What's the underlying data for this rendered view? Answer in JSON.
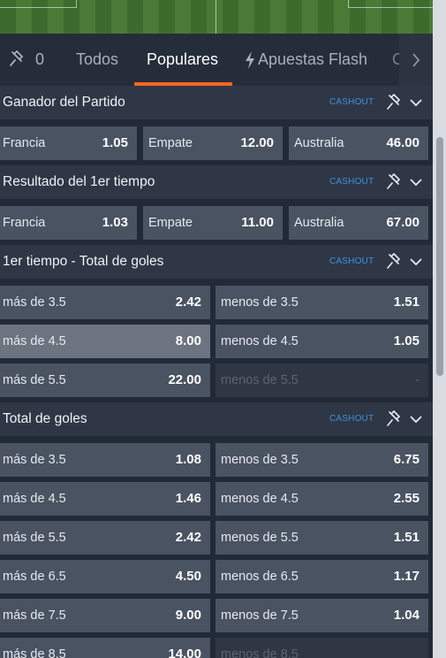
{
  "tabs": {
    "pinned_count": "0",
    "items": [
      "Todos",
      "Populares",
      "Apuestas Flash",
      "C"
    ],
    "active": "Populares",
    "accent_color": "#f26522"
  },
  "markets": [
    {
      "title": "Ganador del Partido",
      "cashout": "CASHOUT",
      "outcomes": [
        {
          "label": "Francia",
          "odds": "1.05"
        },
        {
          "label": "Empate",
          "odds": "12.00"
        },
        {
          "label": "Australia",
          "odds": "46.00"
        }
      ]
    },
    {
      "title": "Resultado del 1er tiempo",
      "cashout": "CASHOUT",
      "outcomes": [
        {
          "label": "Francia",
          "odds": "1.03"
        },
        {
          "label": "Empate",
          "odds": "11.00"
        },
        {
          "label": "Australia",
          "odds": "67.00"
        }
      ]
    },
    {
      "title": "1er tiempo - Total de goles",
      "cashout": "CASHOUT",
      "rows": [
        {
          "over": {
            "label": "más de 3.5",
            "odds": "2.42"
          },
          "under": {
            "label": "menos de 3.5",
            "odds": "1.51"
          }
        },
        {
          "over": {
            "label": "más de 4.5",
            "odds": "8.00"
          },
          "under": {
            "label": "menos de 4.5",
            "odds": "1.05"
          }
        },
        {
          "over": {
            "label": "más de 5.5",
            "odds": "22.00"
          },
          "under": {
            "label": "menos de 5.5",
            "odds": "-"
          }
        }
      ]
    },
    {
      "title": "Total de goles",
      "cashout": "CASHOUT",
      "rows": [
        {
          "over": {
            "label": "más de 3.5",
            "odds": "1.08"
          },
          "under": {
            "label": "menos de 3.5",
            "odds": "6.75"
          }
        },
        {
          "over": {
            "label": "más de 4.5",
            "odds": "1.46"
          },
          "under": {
            "label": "menos de 4.5",
            "odds": "2.55"
          }
        },
        {
          "over": {
            "label": "más de 5.5",
            "odds": "2.42"
          },
          "under": {
            "label": "menos de 5.5",
            "odds": "1.51"
          }
        },
        {
          "over": {
            "label": "más de 6.5",
            "odds": "4.50"
          },
          "under": {
            "label": "menos de 6.5",
            "odds": "1.17"
          }
        },
        {
          "over": {
            "label": "más de 7.5",
            "odds": "9.00"
          },
          "under": {
            "label": "menos de 7.5",
            "odds": "1.04"
          }
        },
        {
          "over": {
            "label": "más de 8.5",
            "odds": "14.00"
          },
          "under": {
            "label": "menos de 8.5",
            "odds": ""
          }
        }
      ]
    }
  ]
}
